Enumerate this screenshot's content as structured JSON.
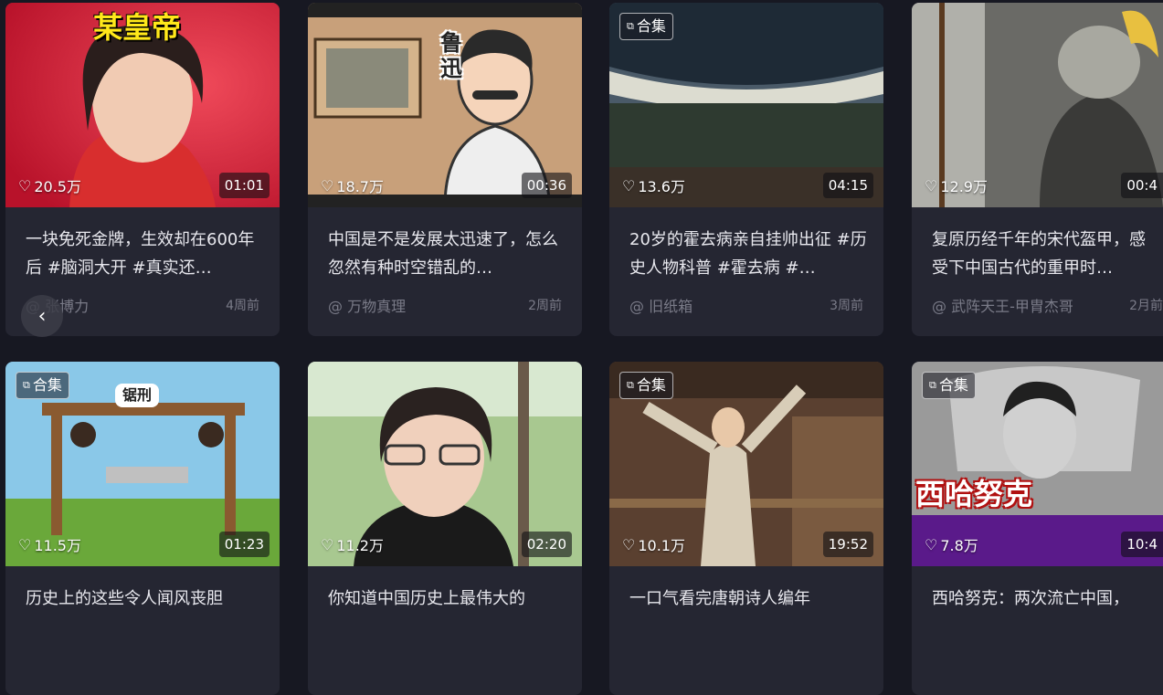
{
  "nav": {
    "prev_glyph": "‹",
    "prev_icon": "chevron-left-icon"
  },
  "ui": {
    "heart_glyph": "♡",
    "collection_glyph": "⧉"
  },
  "videos": [
    {
      "badge": "",
      "likes": "20.5万",
      "duration": "01:01",
      "title": "一块免死金牌，生效却在600年后 #脑洞大开 #真实还…",
      "author": "@ 张博力",
      "time": "4周前",
      "thumb_text": "某皇帝"
    },
    {
      "badge": "",
      "likes": "18.7万",
      "duration": "00:36",
      "title": "中国是不是发展太迅速了，怎么忽然有种时空错乱的…",
      "author": "@ 万物真理",
      "time": "2周前",
      "thumb_text": "鲁迅"
    },
    {
      "badge": "合集",
      "likes": "13.6万",
      "duration": "04:15",
      "title": "20岁的霍去病亲自挂帅出征 #历史人物科普 #霍去病 #…",
      "author": "@ 旧纸箱",
      "time": "3周前",
      "thumb_text": ""
    },
    {
      "badge": "",
      "likes": "12.9万",
      "duration": "00:4",
      "title": "复原历经千年的宋代盔甲，感受下中国古代的重甲时…",
      "author": "@ 武阵天王-甲胄杰哥",
      "time": "2月前",
      "thumb_text": ""
    },
    {
      "badge": "合集",
      "likes": "11.5万",
      "duration": "01:23",
      "title": "历史上的这些令人闻风丧胆",
      "author": "",
      "time": "",
      "thumb_text": "锯刑"
    },
    {
      "badge": "",
      "likes": "11.2万",
      "duration": "02:20",
      "title": "你知道中国历史上最伟大的",
      "author": "",
      "time": "",
      "thumb_text": ""
    },
    {
      "badge": "合集",
      "likes": "10.1万",
      "duration": "19:52",
      "title": "一口气看完唐朝诗人编年",
      "author": "",
      "time": "",
      "thumb_text": ""
    },
    {
      "badge": "合集",
      "likes": "7.8万",
      "duration": "10:4",
      "title": "西哈努克：两次流亡中国，",
      "author": "",
      "time": "",
      "thumb_text": "西哈努克"
    }
  ]
}
